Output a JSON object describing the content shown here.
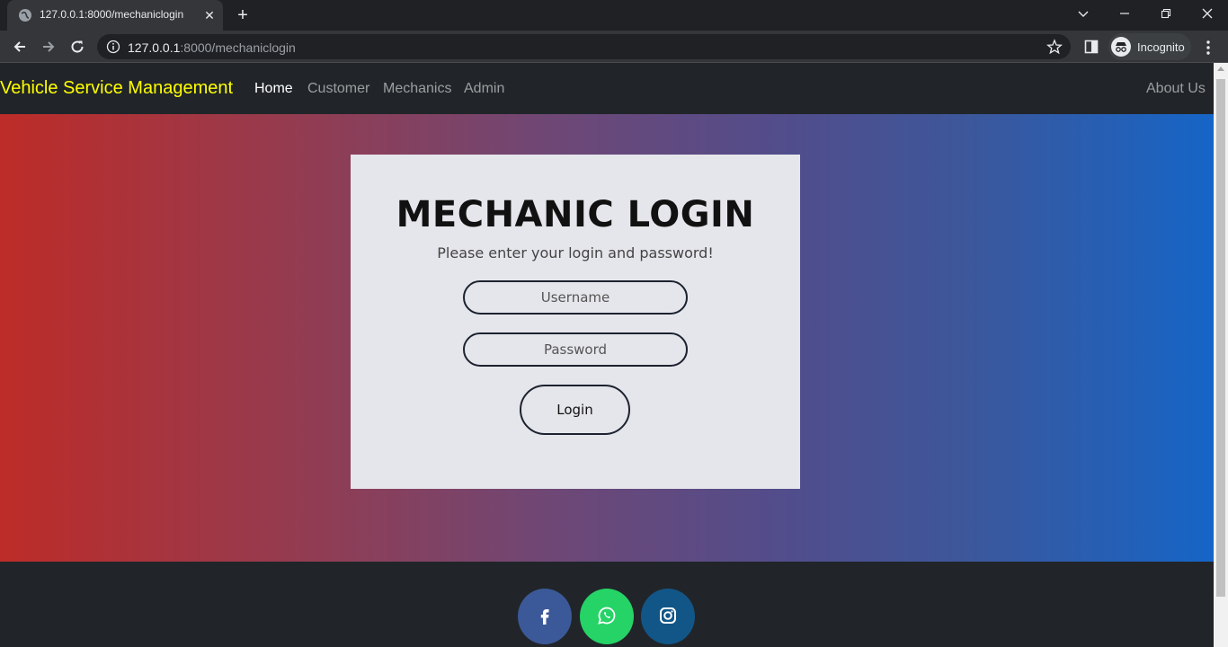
{
  "browser": {
    "tab_title": "127.0.0.1:8000/mechaniclogin",
    "url_host": "127.0.0.1",
    "url_path": ":8000/mechaniclogin",
    "incognito_label": "Incognito"
  },
  "navbar": {
    "brand": "Vehicle Service Management",
    "links": [
      "Home",
      "Customer",
      "Mechanics",
      "Admin"
    ],
    "about": "About Us"
  },
  "login": {
    "title": "MECHANIC LOGIN",
    "subtitle": "Please enter your login and password!",
    "username_placeholder": "Username",
    "password_placeholder": "Password",
    "button": "Login"
  },
  "footer": {
    "socials": [
      "facebook-icon",
      "whatsapp-icon",
      "instagram-icon"
    ]
  },
  "colors": {
    "brand": "#ffff00",
    "gradient_start": "#bd2c28",
    "gradient_end": "#1565c7",
    "facebook": "#3b5998",
    "whatsapp": "#25d366",
    "instagram": "#125688"
  }
}
